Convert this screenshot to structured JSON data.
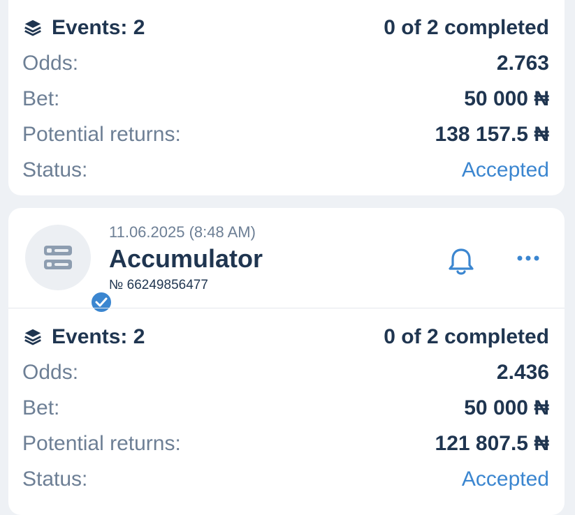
{
  "bets": [
    {
      "events_label": "Events: 2",
      "completed": "0 of 2 completed",
      "odds_label": "Odds:",
      "odds": "2.763",
      "bet_label": "Bet:",
      "bet": "50 000 ₦",
      "returns_label": "Potential returns:",
      "returns": "138 157.5 ₦",
      "status_label": "Status:",
      "status": "Accepted"
    },
    {
      "date": "11.06.2025 (8:48 AM)",
      "type": "Accumulator",
      "ticket": "№ 66249856477",
      "events_label": "Events: 2",
      "completed": "0 of 2 completed",
      "odds_label": "Odds:",
      "odds": "2.436",
      "bet_label": "Bet:",
      "bet": "50 000 ₦",
      "returns_label": "Potential returns:",
      "returns": "121 807.5 ₦",
      "status_label": "Status:",
      "status": "Accepted"
    }
  ],
  "colors": {
    "accent": "#3b86d0",
    "text_dark": "#1f3550",
    "text_muted": "#6d7f95",
    "card_bg": "#ffffff",
    "page_bg": "#eef1f5"
  },
  "icons": {
    "events": "layers-icon",
    "bet_type": "accumulator-icon",
    "verified": "check-badge-icon",
    "notify": "bell-icon",
    "menu": "more-icon"
  }
}
